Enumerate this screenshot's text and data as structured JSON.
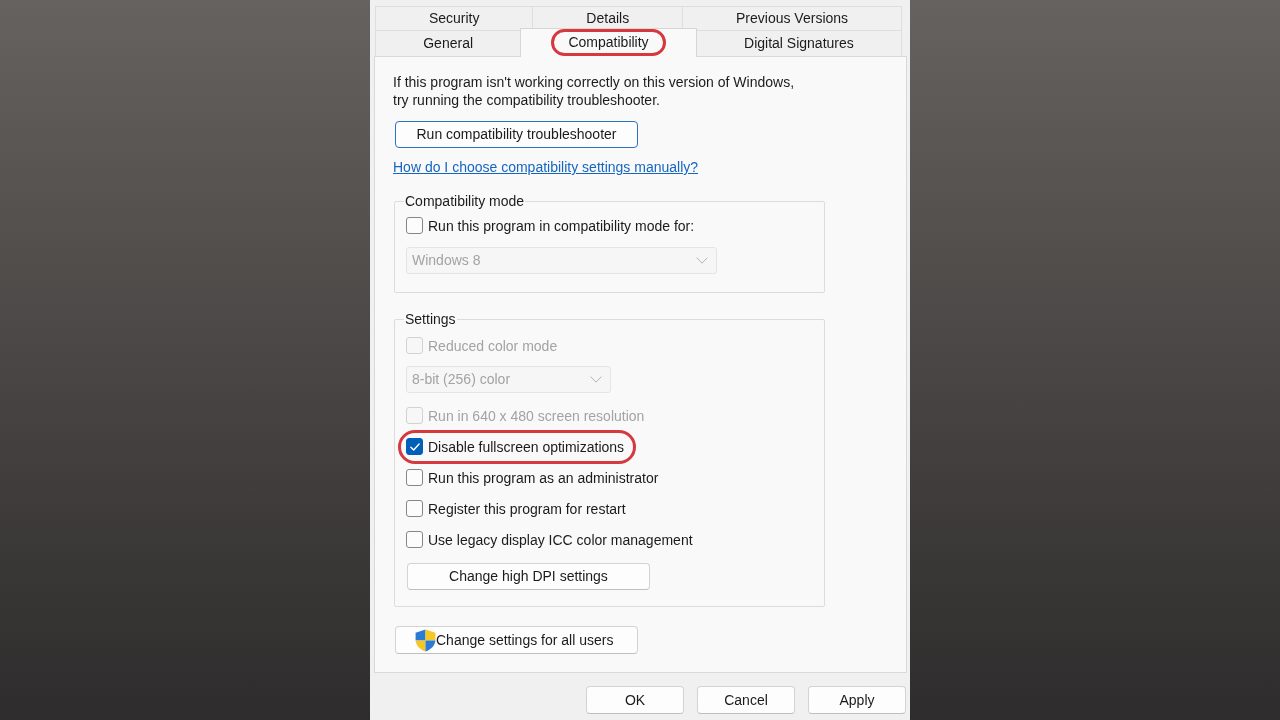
{
  "tab_rows": [
    {
      "tabs": [
        {
          "label": "Security",
          "selected": false,
          "highlighted": false
        },
        {
          "label": "Details",
          "selected": false,
          "highlighted": false
        },
        {
          "label": "Previous Versions",
          "selected": false,
          "highlighted": false
        }
      ]
    },
    {
      "tabs": [
        {
          "label": "General",
          "selected": false,
          "highlighted": false
        },
        {
          "label": "Compatibility",
          "selected": true,
          "highlighted": true
        },
        {
          "label": "Digital Signatures",
          "selected": false,
          "highlighted": false
        }
      ]
    }
  ],
  "intro_lines": [
    "If this program isn't working correctly on this version of Windows,",
    "try running the compatibility troubleshooter."
  ],
  "troubleshooter_button": {
    "label": "Run compatibility troubleshooter",
    "focused": true
  },
  "help_link": {
    "label": "How do I choose compatibility settings manually?"
  },
  "compatibility_mode": {
    "legend": "Compatibility mode",
    "checkbox": {
      "label": "Run this program in compatibility mode for:",
      "checked": false,
      "disabled": false
    },
    "dropdown": {
      "value": "Windows 8",
      "disabled": true
    }
  },
  "settings": {
    "legend": "Settings",
    "items": [
      {
        "kind": "checkbox",
        "label": "Reduced color mode",
        "checked": false,
        "disabled": true,
        "highlighted": false
      },
      {
        "kind": "dropdown",
        "value": "8-bit (256) color",
        "disabled": true,
        "highlighted": false
      },
      {
        "kind": "checkbox",
        "label": "Run in 640 x 480 screen resolution",
        "checked": false,
        "disabled": true,
        "highlighted": false
      },
      {
        "kind": "checkbox",
        "label": "Disable fullscreen optimizations",
        "checked": true,
        "disabled": false,
        "highlighted": true
      },
      {
        "kind": "checkbox",
        "label": "Run this program as an administrator",
        "checked": false,
        "disabled": false,
        "highlighted": false
      },
      {
        "kind": "checkbox",
        "label": "Register this program for restart",
        "checked": false,
        "disabled": false,
        "highlighted": false
      },
      {
        "kind": "checkbox",
        "label": "Use legacy display ICC color management",
        "checked": false,
        "disabled": false,
        "highlighted": false
      },
      {
        "kind": "button",
        "label": "Change high DPI settings",
        "disabled": false,
        "highlighted": false
      }
    ]
  },
  "all_users_button": {
    "label": "Change settings for all users"
  },
  "footer_buttons": [
    {
      "label": "OK"
    },
    {
      "label": "Cancel"
    },
    {
      "label": "Apply"
    }
  ]
}
